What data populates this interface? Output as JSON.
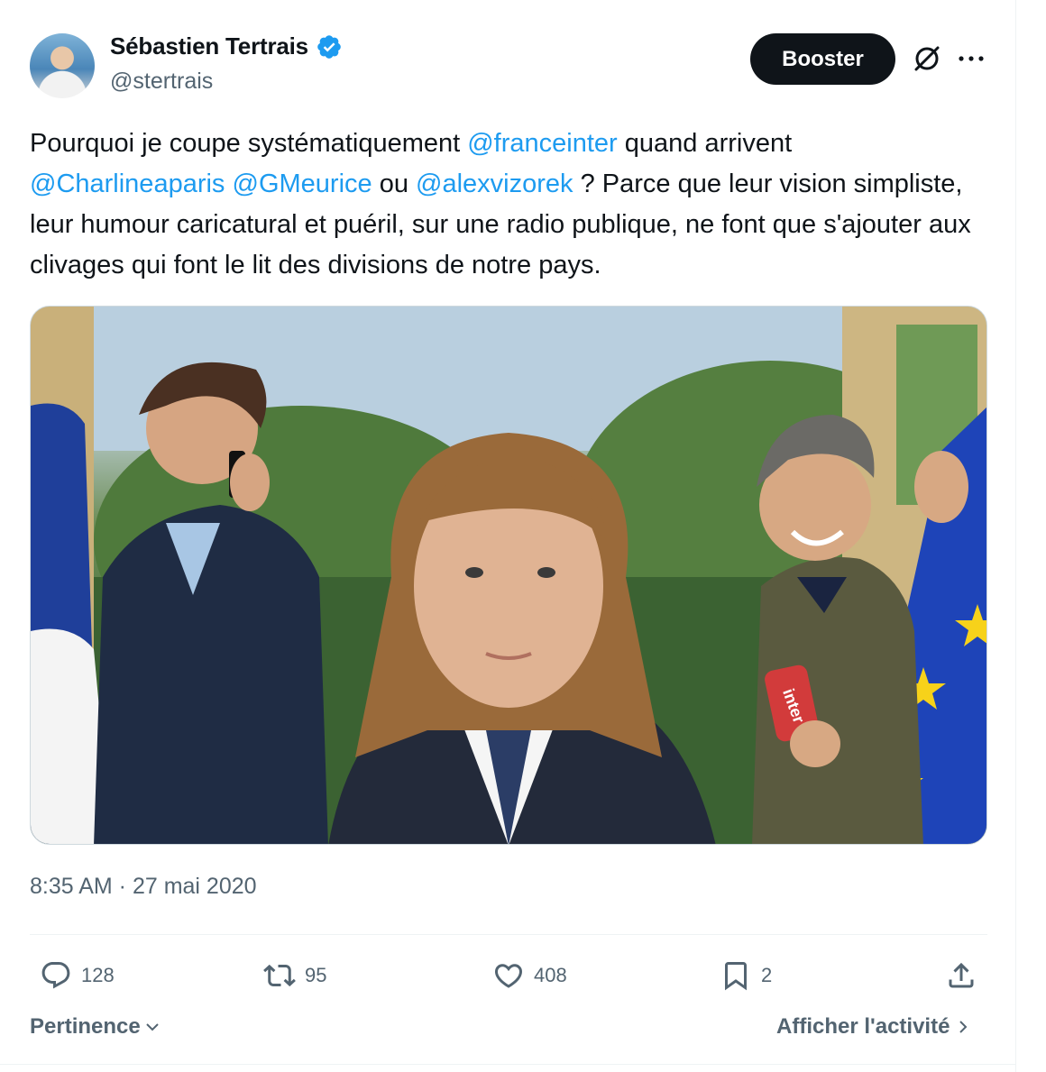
{
  "tweet": {
    "author_name": "Sébastien Tertrais",
    "author_handle": "@stertrais",
    "verified": true,
    "body": {
      "t1": "Pourquoi je coupe systématiquement ",
      "m1": "@franceinter",
      "t2": " quand arrivent ",
      "m2": "@Charlineaparis",
      "t3": " ",
      "m3": "@GMeurice",
      "t4": " ou ",
      "m4": "@alexvizorek",
      "t5": " ? Parce que leur vision simpliste, leur humour caricatural et puéril, sur une radio publique, ne font que s'ajouter aux clivages qui font le lit des divisions de notre pays."
    },
    "timestamp": "8:35 AM · 27 mai 2020"
  },
  "header": {
    "booster_label": "Booster",
    "grok_icon": "grok-icon",
    "more_icon": "more-icon"
  },
  "media": {
    "image_text": "inter"
  },
  "actions": {
    "replies": "128",
    "retweets": "95",
    "likes": "408",
    "bookmarks": "2"
  },
  "footer": {
    "sort_label": "Pertinence",
    "activity_label": "Afficher l'activité"
  },
  "colors": {
    "accent": "#1d9bf0",
    "text": "#0f1419",
    "muted": "#536471",
    "button_bg": "#0f1419"
  }
}
